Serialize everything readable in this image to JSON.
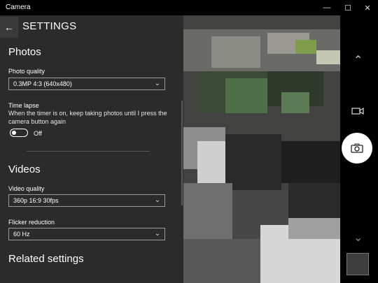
{
  "window": {
    "title": "Camera",
    "minimize": "—",
    "maximize": "☐",
    "close": "✕"
  },
  "settings": {
    "title": "SETTINGS",
    "back_icon": "←",
    "photos": {
      "heading": "Photos",
      "photo_quality_label": "Photo quality",
      "photo_quality_value": "0.3MP 4:3 (640x480)",
      "time_lapse_label": "Time lapse",
      "time_lapse_desc": "When the timer is on, keep taking photos until I press the camera button again",
      "time_lapse_state": "Off"
    },
    "videos": {
      "heading": "Videos",
      "video_quality_label": "Video quality",
      "video_quality_value": "360p 16:9 30fps",
      "flicker_label": "Flicker reduction",
      "flicker_value": "60 Hz"
    },
    "related_heading": "Related settings"
  },
  "icons": {
    "chevron_up": "chevron-up-icon",
    "video_mode": "video-camera-icon",
    "capture": "photo-camera-icon",
    "chevron_down": "chevron-down-icon"
  },
  "colors": {
    "panel_bg": "#2b2b2b",
    "capture_bg": "#ffffff"
  }
}
